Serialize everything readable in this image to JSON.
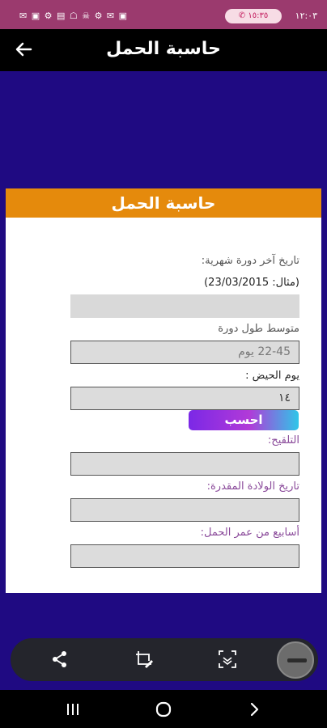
{
  "status": {
    "time": "١٢:٠٣",
    "call_timer": "١٥:٣٥",
    "notification_icons": "✉ ▣ ⚙ ▤ ☖ ☠ ⚙ ✉ ▣"
  },
  "appbar": {
    "title": "حاسبة الحمل"
  },
  "card": {
    "title": "حاسبة الحمل"
  },
  "form": {
    "last_period_label": "تاريخ آخر دورة شهرية:",
    "example_label": "(مثال: 23/03/2015)",
    "last_period_value": "",
    "cycle_label": "متوسط طول دورة",
    "cycle_value": "22-45 يوم",
    "period_day_label": "يوم الحيض :",
    "period_day_value": "١٤",
    "calc_button": "احسب",
    "fertilization_label": "التلقيح:",
    "fertilization_value": "",
    "due_date_label": "تاريخ الولادة المقدرة:",
    "due_date_value": "",
    "weeks_label": "أسابيع من عمر الحمل:",
    "weeks_value": ""
  },
  "toolbar": {
    "items": [
      "share-icon",
      "edit-crop-icon",
      "scan-icon",
      "floating-bubble"
    ]
  },
  "navbar": {
    "items": [
      "recents-icon",
      "home-icon",
      "back-chevron-icon"
    ]
  }
}
